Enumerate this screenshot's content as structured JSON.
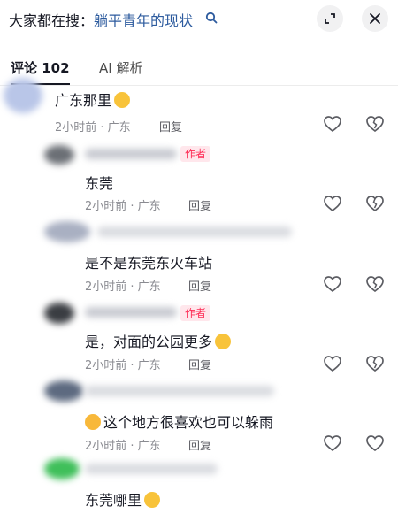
{
  "header": {
    "search_prefix": "大家都在搜：",
    "search_term": "躺平青年的现状"
  },
  "tabs": {
    "comments": "评论 102",
    "ai": "AI 解析"
  },
  "labels": {
    "reply": "回复",
    "author": "作者"
  },
  "comments": [
    {
      "text": "广东那里",
      "meta": "2小时前 · 广东",
      "emoji": "surprised-face-emoji"
    },
    {
      "text": "东莞",
      "meta": "2小时前 · 广东",
      "author": true
    },
    {
      "text": "是不是东莞东火车站",
      "meta": "2小时前 · 广东"
    },
    {
      "text": "是，对面的公园更多",
      "meta": "2小时前 · 广东",
      "author": true,
      "emoji": "laughing-face-emoji"
    },
    {
      "text": "这个地方很喜欢也可以躲雨",
      "meta": "2小时前 · 广东",
      "emoji": "thumbs-up-emoji"
    },
    {
      "text": "东莞哪里",
      "emoji": "grinning-face-emoji"
    }
  ],
  "colors": {
    "accent": "#fe2c55",
    "link": "#2d5b9e",
    "muted": "#8a8b91"
  }
}
